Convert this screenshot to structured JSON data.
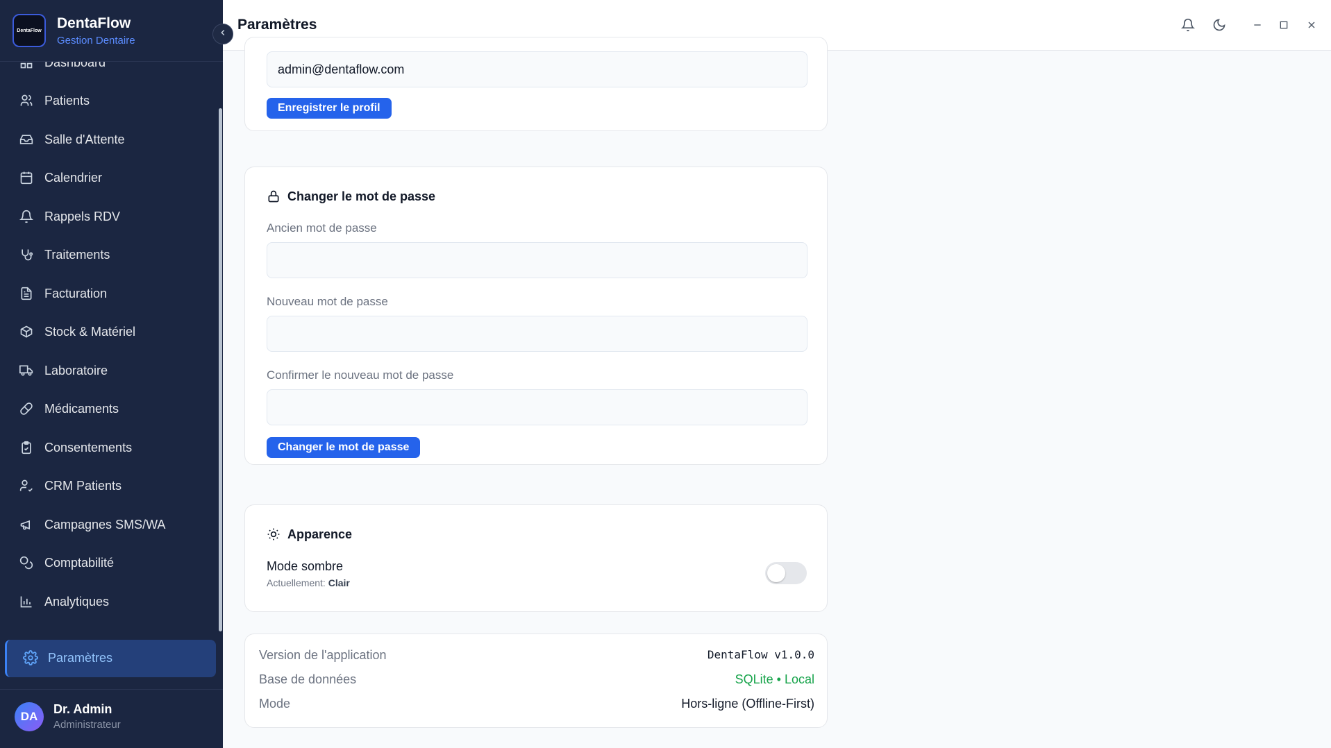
{
  "brand": {
    "name": "DentaFlow",
    "subtitle": "Gestion Dentaire",
    "logo_text": "DentaFlow"
  },
  "sidebar": {
    "items": [
      {
        "label": "Dashboard",
        "icon": "grid-icon"
      },
      {
        "label": "Patients",
        "icon": "users-icon"
      },
      {
        "label": "Salle d'Attente",
        "icon": "inbox-icon"
      },
      {
        "label": "Calendrier",
        "icon": "calendar-icon"
      },
      {
        "label": "Rappels RDV",
        "icon": "bell-icon"
      },
      {
        "label": "Traitements",
        "icon": "stethoscope-icon"
      },
      {
        "label": "Facturation",
        "icon": "file-text-icon"
      },
      {
        "label": "Stock & Matériel",
        "icon": "package-icon"
      },
      {
        "label": "Laboratoire",
        "icon": "truck-icon"
      },
      {
        "label": "Médicaments",
        "icon": "pill-icon"
      },
      {
        "label": "Consentements",
        "icon": "clipboard-check-icon"
      },
      {
        "label": "CRM Patients",
        "icon": "user-check-icon"
      },
      {
        "label": "Campagnes SMS/WA",
        "icon": "megaphone-icon"
      },
      {
        "label": "Comptabilité",
        "icon": "coins-icon"
      },
      {
        "label": "Analytiques",
        "icon": "bar-chart-icon"
      }
    ],
    "active": {
      "label": "Paramètres",
      "icon": "gear-icon"
    }
  },
  "user": {
    "initials": "DA",
    "name": "Dr. Admin",
    "role": "Administrateur"
  },
  "header": {
    "title": "Paramètres"
  },
  "profile": {
    "email_value": "admin@dentaflow.com",
    "save_label": "Enregistrer le profil"
  },
  "password": {
    "title": "Changer le mot de passe",
    "old_label": "Ancien mot de passe",
    "new_label": "Nouveau mot de passe",
    "confirm_label": "Confirmer le nouveau mot de passe",
    "submit_label": "Changer le mot de passe"
  },
  "appearance": {
    "title": "Apparence",
    "dark_mode_label": "Mode sombre",
    "current_prefix": "Actuellement:",
    "current_value": "Clair",
    "dark_mode_on": false
  },
  "about": {
    "rows": [
      {
        "key": "Version de l'application",
        "value": "DentaFlow v1.0.0"
      },
      {
        "key": "Base de données",
        "value": "SQLite • Local"
      },
      {
        "key": "Mode",
        "value": "Hors-ligne (Offline-First)"
      }
    ]
  },
  "colors": {
    "sidebar_bg": "#1b2641",
    "accent": "#2563eb",
    "success": "#16a34a"
  }
}
